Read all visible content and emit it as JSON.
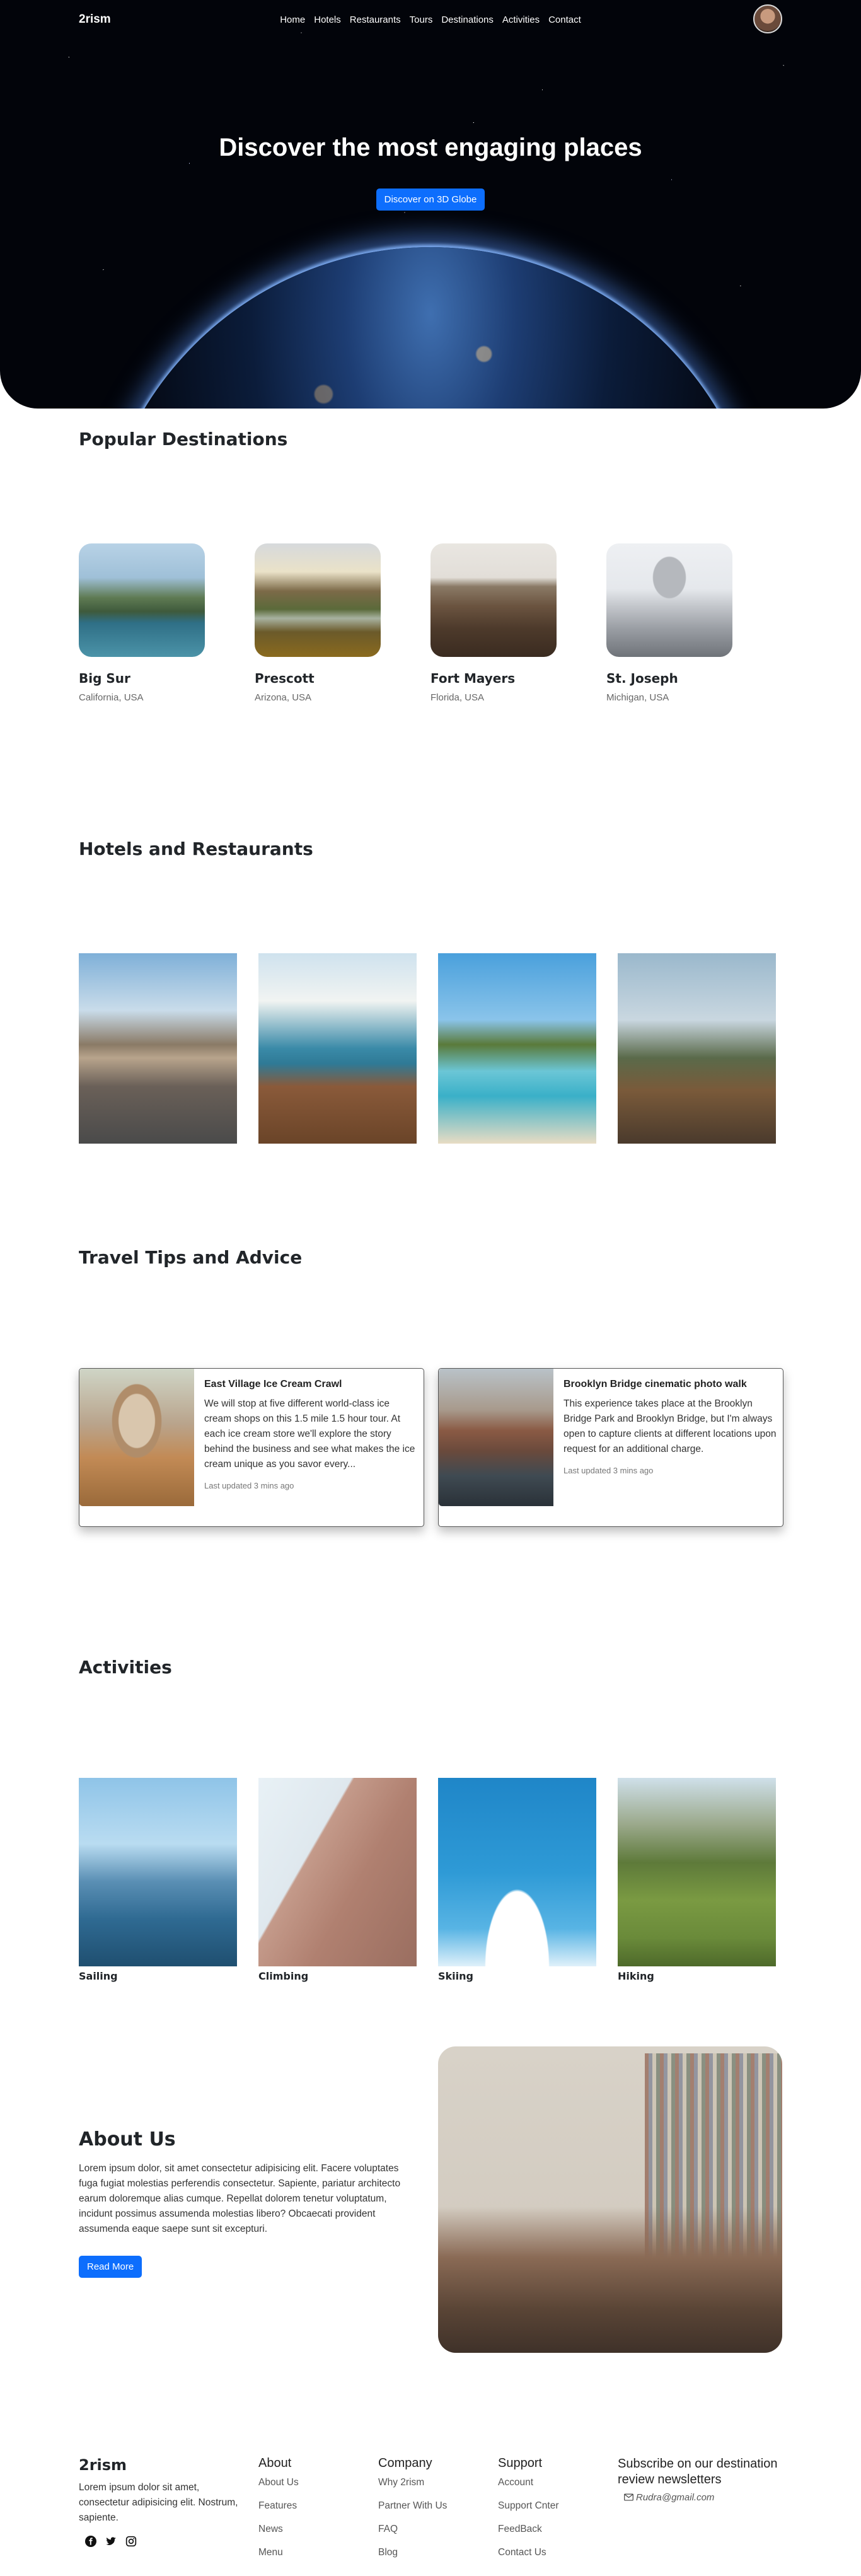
{
  "brand": "2rism",
  "nav": {
    "links": [
      "Home",
      "Hotels",
      "Restaurants",
      "Tours",
      "Destinations",
      "Activities",
      "Contact"
    ]
  },
  "hero": {
    "title": "Discover the most engaging places",
    "button": "Discover on 3D Globe"
  },
  "destinations": {
    "title": "Popular Destinations",
    "items": [
      {
        "name": "Big Sur",
        "location": "California, USA"
      },
      {
        "name": "Prescott",
        "location": "Arizona, USA"
      },
      {
        "name": "Fort Mayers",
        "location": "Florida, USA"
      },
      {
        "name": "St. Joseph",
        "location": "Michigan, USA"
      }
    ]
  },
  "hotels": {
    "title": "Hotels and Restaurants"
  },
  "tips": {
    "title": "Travel Tips and Advice",
    "items": [
      {
        "title": "East Village Ice Cream Crawl",
        "text": "We will stop at five different world-class ice cream shops on this 1.5 mile 1.5 hour tour. At each ice cream store we'll explore the story behind the business and see what makes the ice cream unique as you savor every...",
        "meta": "Last updated 3 mins ago"
      },
      {
        "title": "Brooklyn Bridge cinematic photo walk",
        "text": "This experience takes place at the Brooklyn Bridge Park and Brooklyn Bridge, but I'm always open to capture clients at different locations upon request for an additional charge.",
        "meta": "Last updated 3 mins ago"
      }
    ]
  },
  "activities": {
    "title": "Activities",
    "items": [
      "Sailing",
      "Climbing",
      "Skiing",
      "Hiking"
    ]
  },
  "about": {
    "title": "About Us",
    "text": "Lorem ipsum dolor, sit amet consectetur adipisicing elit. Facere voluptates fuga fugiat molestias perferendis consectetur. Sapiente, pariatur architecto earum doloremque alias cumque. Repellat dolorem tenetur voluptatum, incidunt possimus assumenda molestias libero? Obcaecati provident assumenda eaque saepe sunt sit excepturi.",
    "button": "Read More"
  },
  "footer": {
    "brand": "2rism",
    "description": "Lorem ipsum dolor sit amet, consectetur adipisicing elit. Nostrum, sapiente.",
    "columns": [
      {
        "title": "About",
        "links": [
          "About Us",
          "Features",
          "News",
          "Menu"
        ]
      },
      {
        "title": "Company",
        "links": [
          "Why 2rism",
          "Partner With Us",
          "FAQ",
          "Blog"
        ]
      },
      {
        "title": "Support",
        "links": [
          "Account",
          "Support Cnter",
          "FeedBack",
          "Contact Us"
        ]
      }
    ],
    "subscribe": {
      "title": "Subscribe on our destination review newsletters",
      "placeholder": "Rudra@gmail.com"
    },
    "socials": [
      "facebook-icon",
      "twitter-icon",
      "instagram-icon"
    ]
  }
}
